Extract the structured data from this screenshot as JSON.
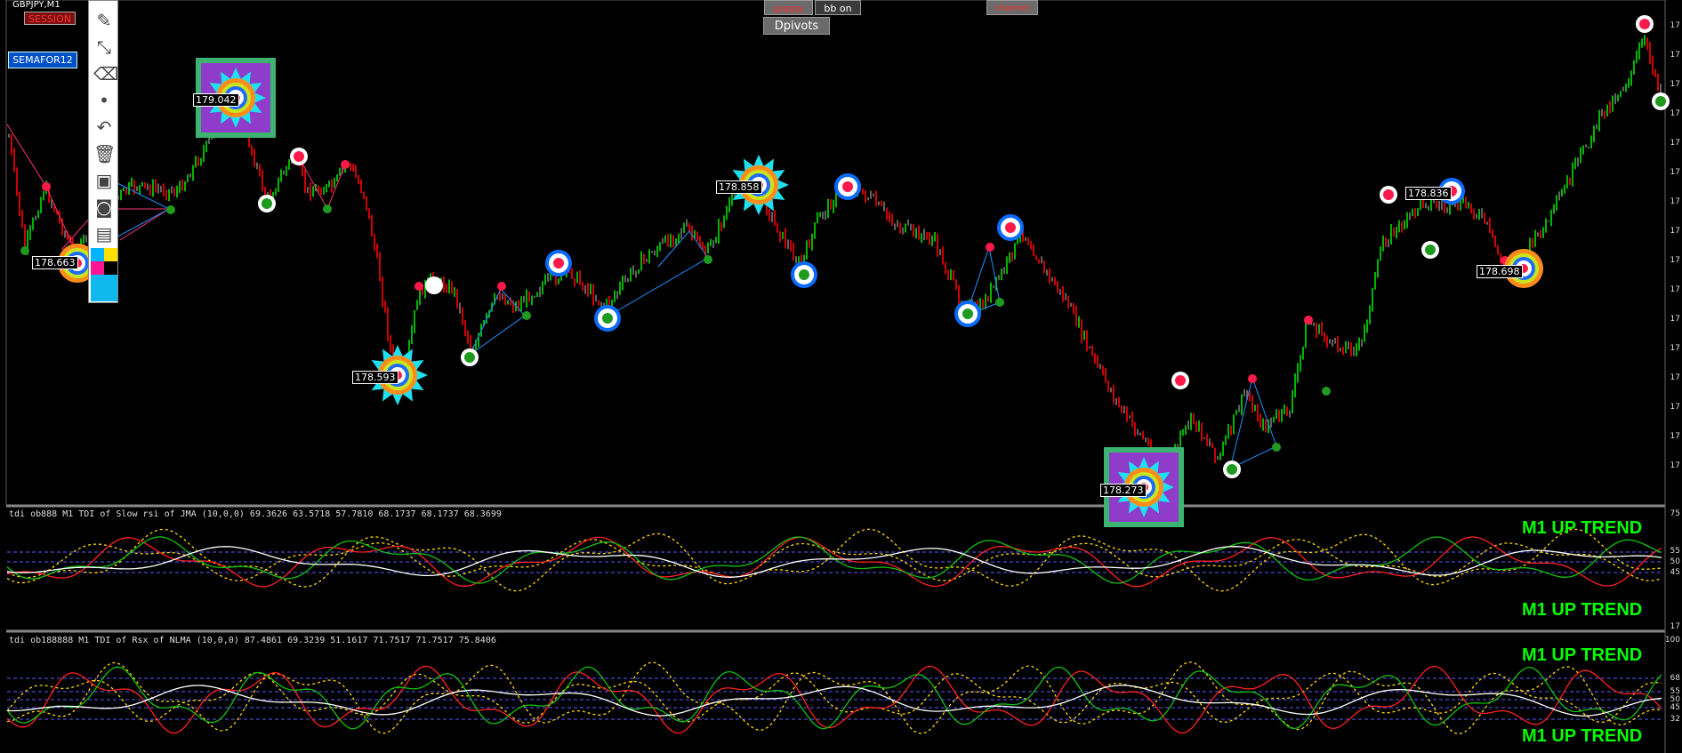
{
  "symbol": "GBPJPY,M1",
  "buttons": {
    "session": "SESSION",
    "semafor": "SEMAFOR12",
    "guppy": "guppy",
    "bb": "bb on",
    "channel": "channel",
    "dpivots": "Dpivots"
  },
  "price_labels": [
    "179.042",
    "178.663",
    "178.593",
    "178.858",
    "178.273",
    "178.836",
    "178.698"
  ],
  "subwindow1": {
    "title": "tdi ob888 M1 TDI of Slow rsi of JMA (10,0,0) 69.3626 63.5718 57.7810 68.1737 68.1737 68.3699",
    "trend_top": "M1 UP TREND",
    "trend_bottom": "M1 UP TREND",
    "axis": [
      "75",
      "55",
      "50",
      "45",
      "17"
    ]
  },
  "subwindow2": {
    "title": "tdi ob188888 M1 TDI of Rsx of NLMA (10,0,0) 87.4861 69.3239 51.1617 71.7517 71.7517 75.8406",
    "trend_top": "M1 UP TREND",
    "trend_bottom": "M1 UP TREND",
    "axis": [
      "100",
      "68",
      "55",
      "50",
      "45",
      "32"
    ]
  },
  "main_axis": [
    "17",
    "17",
    "17",
    "17",
    "17",
    "17",
    "17",
    "17",
    "17",
    "17",
    "17",
    "17",
    "17",
    "17",
    "17",
    "17"
  ],
  "colors": {
    "bull": "#00e000",
    "bear": "#ff0000",
    "neutral": "#7a7a7a",
    "level_line": "#5b5bff",
    "trend_text": "#00ff00"
  },
  "icons": [
    "pencil-icon",
    "line-tool-icon",
    "eraser-icon",
    "dot-icon",
    "undo-icon",
    "trash-icon",
    "tv-icon",
    "camera-icon",
    "clipboard-icon",
    "palette-icon"
  ]
}
